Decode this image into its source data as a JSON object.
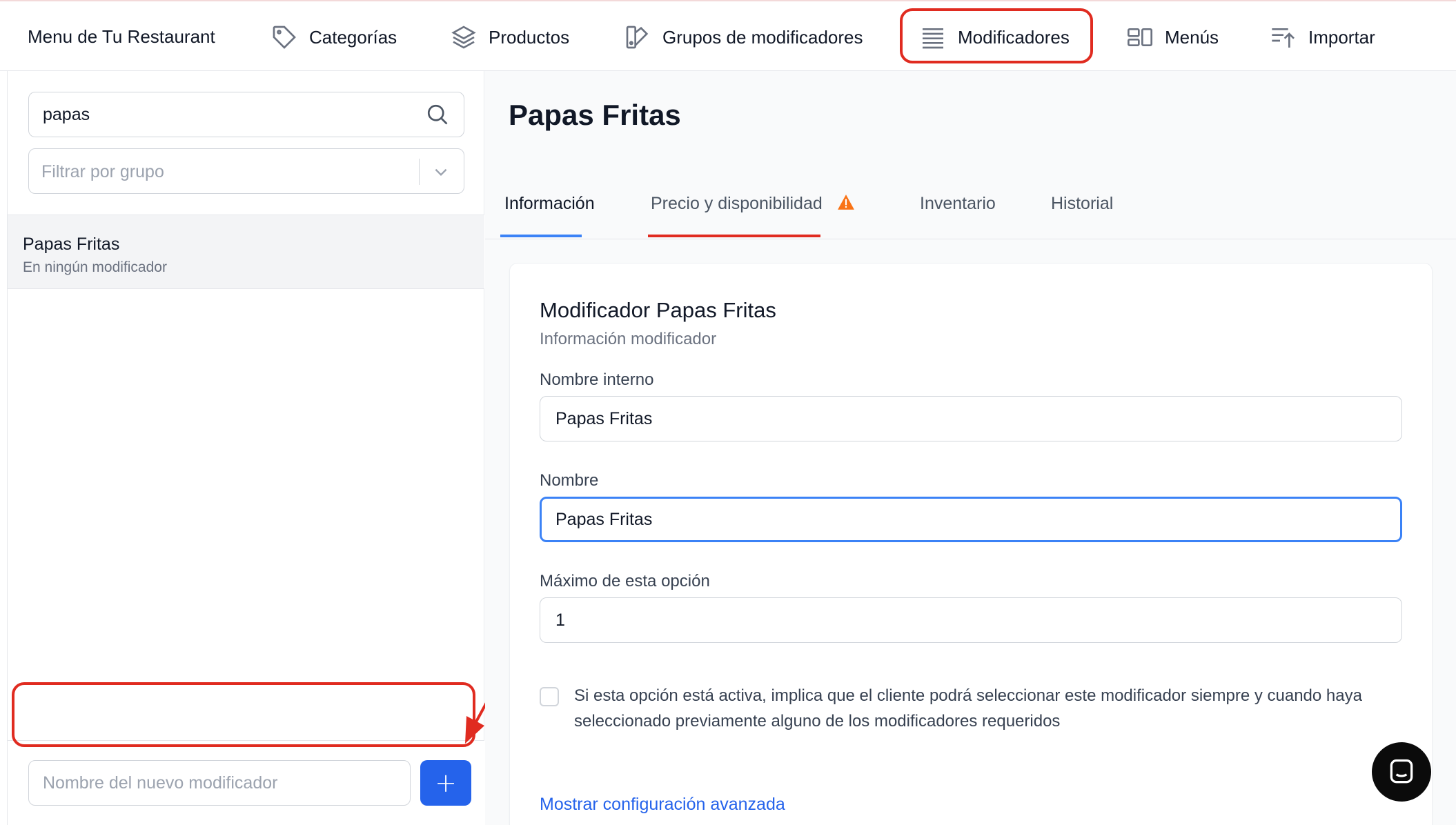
{
  "topnav": {
    "brand": "Menu de Tu Restaurant",
    "items": [
      {
        "label": "Categorías",
        "icon": "tag-icon"
      },
      {
        "label": "Productos",
        "icon": "layers-icon"
      },
      {
        "label": "Grupos de modificadores",
        "icon": "swatch-icon"
      },
      {
        "label": "Modificadores",
        "icon": "list-icon",
        "highlighted": true
      },
      {
        "label": "Menús",
        "icon": "layout-icon"
      },
      {
        "label": "Importar",
        "icon": "import-icon"
      }
    ]
  },
  "sidebar": {
    "search_value": "papas",
    "filter_placeholder": "Filtrar por grupo",
    "items": [
      {
        "title": "Papas Fritas",
        "subtitle": "En ningún modificador"
      }
    ],
    "new_placeholder": "Nombre del nuevo modificador",
    "add_label": "+"
  },
  "main": {
    "title": "Papas Fritas",
    "tabs": [
      {
        "label": "Información",
        "active": true
      },
      {
        "label": "Precio y disponibilidad",
        "warning": true
      },
      {
        "label": "Inventario"
      },
      {
        "label": "Historial"
      }
    ],
    "card": {
      "title": "Modificador Papas Fritas",
      "subtitle": "Información modificador",
      "fields": [
        {
          "label": "Nombre interno",
          "value": "Papas Fritas"
        },
        {
          "label": "Nombre",
          "value": "Papas Fritas"
        },
        {
          "label": "Máximo de esta opción",
          "value": "1"
        }
      ],
      "checkbox_text": "Si esta opción está activa, implica que el cliente podrá seleccionar este modificador siempre y cuando haya seleccionado previamente alguno de los modificadores requeridos",
      "checkbox_checked": false,
      "advanced_link": "Mostrar configuración avanzada"
    }
  },
  "colors": {
    "accent": "#2563eb",
    "highlight": "#e02b20",
    "warning": "#f97316"
  }
}
